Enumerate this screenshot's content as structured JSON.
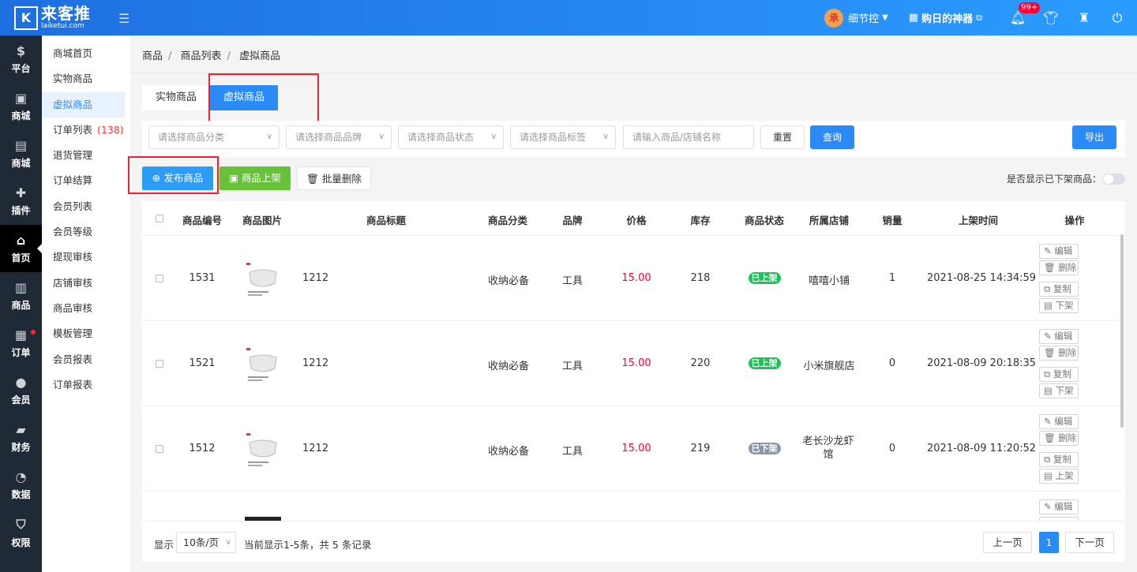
{
  "brand": {
    "name": "来客推",
    "domain": "laiketui.com",
    "logo_glyph": "K"
  },
  "header": {
    "username": "细节控",
    "shop_link": "购日的神器",
    "notification_badge": "99+",
    "avatar_glyph": "承"
  },
  "leftnav": [
    {
      "label": "平台",
      "icon": "dollar-icon",
      "glyph": "$"
    },
    {
      "label": "商城",
      "icon": "image-icon",
      "glyph": "▣"
    },
    {
      "label": "商城",
      "icon": "store-icon",
      "glyph": "▤"
    },
    {
      "label": "插件",
      "icon": "puzzle-icon",
      "glyph": "✚"
    },
    {
      "label": "首页",
      "icon": "home-icon",
      "glyph": "⌂"
    },
    {
      "label": "商品",
      "icon": "inbox-icon",
      "glyph": "▥"
    },
    {
      "label": "订单",
      "icon": "clipboard-icon",
      "glyph": "▦"
    },
    {
      "label": "会员",
      "icon": "user-icon",
      "glyph": "●"
    },
    {
      "label": "财务",
      "icon": "wallet-icon",
      "glyph": "▰"
    },
    {
      "label": "数据",
      "icon": "pie-chart-icon",
      "glyph": "◔"
    },
    {
      "label": "权限",
      "icon": "shield-icon",
      "glyph": "⛉"
    }
  ],
  "subnav": [
    {
      "label": "商城首页"
    },
    {
      "label": "实物商品"
    },
    {
      "label": "虚拟商品"
    },
    {
      "label": "订单列表",
      "count": "(138)"
    },
    {
      "label": "退货管理"
    },
    {
      "label": "订单结算"
    },
    {
      "label": "会员列表"
    },
    {
      "label": "会员等级"
    },
    {
      "label": "提现审核"
    },
    {
      "label": "店铺审核"
    },
    {
      "label": "商品审核"
    },
    {
      "label": "模板管理"
    },
    {
      "label": "会员报表"
    },
    {
      "label": "订单报表"
    }
  ],
  "breadcrumb": [
    "商品",
    "商品列表",
    "虚拟商品"
  ],
  "tabs": [
    "实物商品",
    "虚拟商品"
  ],
  "filters": {
    "category": "请选择商品分类",
    "brand": "请选择商品品牌",
    "status": "请选择商品状态",
    "tag": "请选择商品标签",
    "search_placeholder": "请输入商品/店铺名称",
    "reset": "重置",
    "query": "查询",
    "export": "导出"
  },
  "actions": {
    "publish": "发布商品",
    "shelve": "商品上架",
    "batch_delete": "批量删除",
    "show_off_shelf": "是否显示已下架商品："
  },
  "table": {
    "headers": [
      "商品编号",
      "商品图片",
      "商品标题",
      "商品分类",
      "品牌",
      "价格",
      "库存",
      "商品状态",
      "所属店铺",
      "销量",
      "上架时间",
      "操作"
    ],
    "rows": [
      {
        "id": "1531",
        "title": "1212",
        "category": "收纳必备",
        "brand": "工具",
        "price": "15.00",
        "stock": "218",
        "status": "已上架",
        "shop": "嘻嘻小铺",
        "sales": "1",
        "time": "2021-08-25 14:34:59",
        "ops": [
          "编辑",
          "删除",
          "复制",
          "下架"
        ]
      },
      {
        "id": "1521",
        "title": "1212",
        "category": "收纳必备",
        "brand": "工具",
        "price": "15.00",
        "stock": "220",
        "status": "已上架",
        "shop": "小米旗舰店",
        "sales": "0",
        "time": "2021-08-09 20:18:35",
        "ops": [
          "编辑",
          "删除",
          "复制",
          "下架"
        ]
      },
      {
        "id": "1512",
        "title": "1212",
        "category": "收纳必备",
        "brand": "工具",
        "price": "15.00",
        "stock": "219",
        "status": "已下架",
        "shop": "老长沙龙虾馆",
        "sales": "0",
        "time": "2021-08-09 11:20:52",
        "ops": [
          "编辑",
          "删除",
          "复制",
          "上架"
        ]
      },
      {
        "ops": [
          "编辑"
        ]
      }
    ]
  },
  "pagination": {
    "show_label": "显示",
    "page_size": "10条/页",
    "summary": "当前显示1-5条，共 5 条记录",
    "prev": "上一页",
    "current": "1",
    "next": "下一页"
  },
  "colors": {
    "primary": "#2b8bf6",
    "success": "#67c23a",
    "danger": "#ff0033",
    "on_shelf": "#1fc05a",
    "off_shelf": "#8a97a6",
    "highlight": "#e22233"
  }
}
